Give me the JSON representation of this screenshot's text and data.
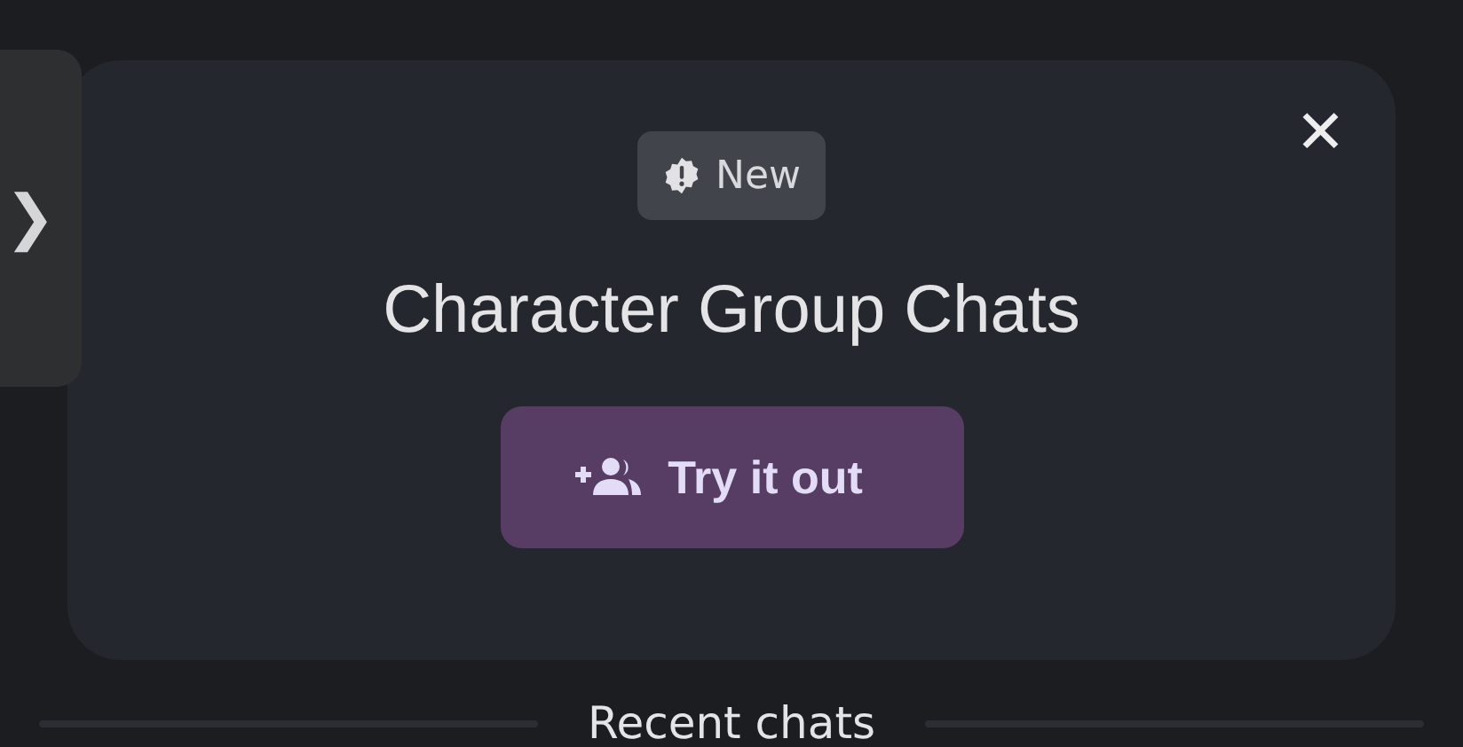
{
  "sidebar_toggle": {
    "label": "❯"
  },
  "promo": {
    "badge": "New",
    "title": "Character Group Chats",
    "button": "Try it out",
    "close": "✕"
  },
  "section_heading": "Recent chats"
}
